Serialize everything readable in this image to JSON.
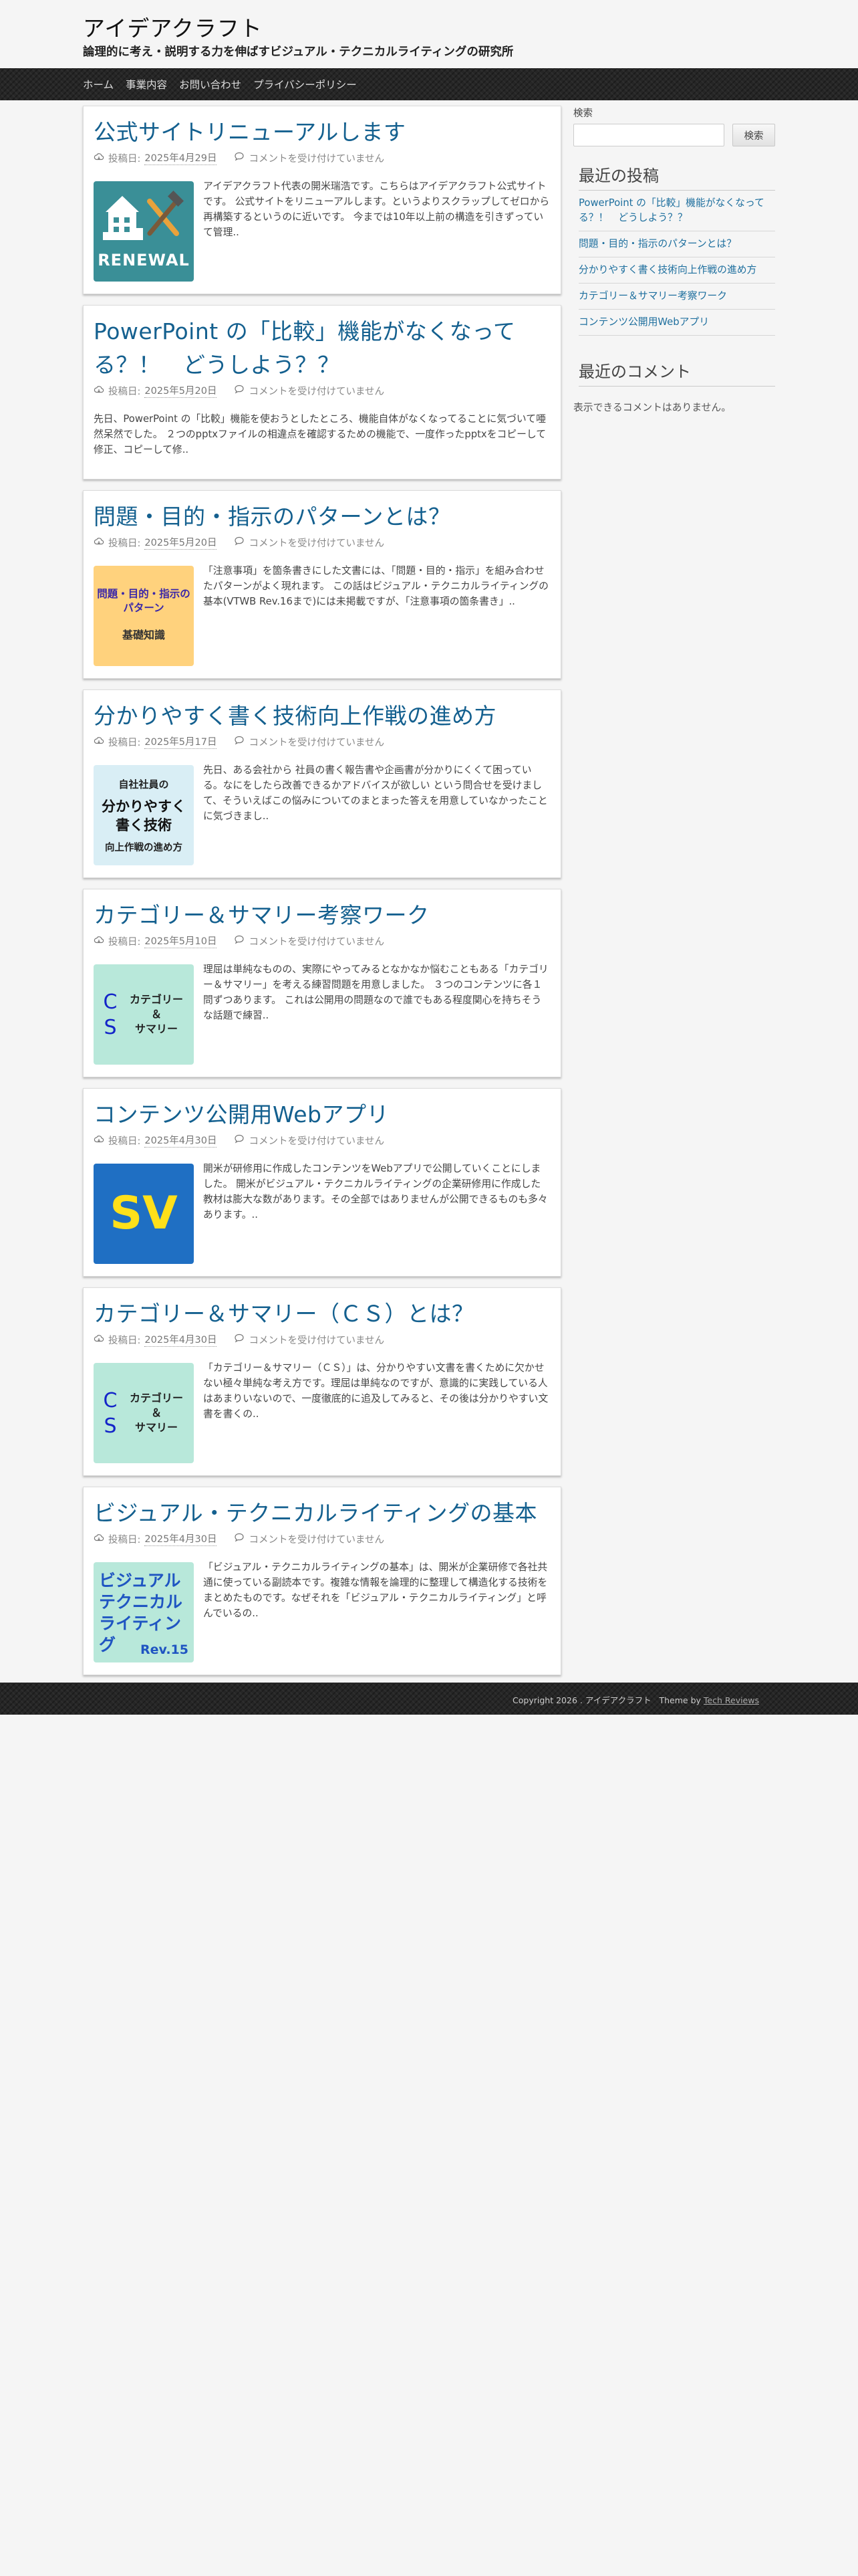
{
  "site": {
    "title": "アイデアクラフト",
    "description": "論理的に考え・説明する力を伸ばすビジュアル・テクニカルライティングの研究所"
  },
  "nav": [
    "ホーム",
    "事業内容",
    "お問い合わせ",
    "プライバシーポリシー"
  ],
  "meta_labels": {
    "posted_on": "投稿日:",
    "comments_closed": "コメントを受け付けていません"
  },
  "posts": [
    {
      "title": "公式サイトリニューアルします",
      "date": "2025年4月29日",
      "thumbnail": {
        "type": "renewal",
        "text": "RENEWAL",
        "icon": "building-tools-icon"
      },
      "excerpt": "アイデアクラフト代表の開米瑞浩です。こちらはアイデアクラフト公式サイトです。 公式サイトをリニューアルします。というよりスクラップしてゼロから再構築するというのに近いです。 今までは10年以上前の構造を引きずっていて管理.."
    },
    {
      "title": "PowerPoint の「比較」機能がなくなってる？！　どうしよう？？",
      "date": "2025年5月20日",
      "thumbnail": null,
      "excerpt": "先日、PowerPoint の「比較」機能を使おうとしたところ、機能自体がなくなってることに気づいて唖然呆然でした。 ２つのpptxファイルの相違点を確認するための機能で、一度作ったpptxをコピーして修正、コピーして修.."
    },
    {
      "title": "問題・目的・指示のパターンとは？",
      "date": "2025年5月20日",
      "thumbnail": {
        "type": "purpose",
        "line1": "問題・目的・指示の\nパターン",
        "line2": "基礎知識"
      },
      "excerpt": "「注意事項」を箇条書きにした文書には、「問題・目的・指示」を組み合わせたパターンがよく現れます。 この話はビジュアル・テクニカルライティングの基本(VTWB Rev.16まで)には未掲載ですが、「注意事項の箇条書き」.."
    },
    {
      "title": "分かりやすく書く技術向上作戦の進め方",
      "date": "2025年5月17日",
      "thumbnail": {
        "type": "write",
        "line1": "自社社員の",
        "line2": "分かりやすく\n書く技術",
        "line3": "向上作戦の進め方"
      },
      "excerpt": "先日、ある会社から 社員の書く報告書や企画書が分かりにくくて困っている。なにをしたら改善できるかアドバイスが欲しい という問合せを受けまして、そういえばこの悩みについてのまとまった答えを用意していなかったことに気づきまし.."
    },
    {
      "title": "カテゴリー＆サマリー考察ワーク",
      "date": "2025年5月10日",
      "thumbnail": {
        "type": "cs",
        "letters": "C\nS",
        "label": "カテゴリー\n＆\nサマリー"
      },
      "excerpt": "理屈は単純なものの、実際にやってみるとなかなか悩むこともある「カテゴリー＆サマリー」を考える練習問題を用意しました。 ３つのコンテンツに各１問ずつあります。 これは公開用の問題なので誰でもある程度関心を持ちそうな話題で練習.."
    },
    {
      "title": "コンテンツ公開用Webアプリ",
      "date": "2025年4月30日",
      "thumbnail": {
        "type": "sv",
        "text": "SV"
      },
      "excerpt": "開米が研修用に作成したコンテンツをWebアプリで公開していくことにしました。 開米がビジュアル・テクニカルライティングの企業研修用に作成した教材は膨大な数があります。その全部ではありませんが公開できるものも多々あります。.."
    },
    {
      "title": "カテゴリー＆サマリー（ＣＳ）とは？",
      "date": "2025年4月30日",
      "thumbnail": {
        "type": "cs",
        "letters": "C\nS",
        "label": "カテゴリー\n＆\nサマリー"
      },
      "excerpt": "「カテゴリー＆サマリー（ＣＳ）」は、分かりやすい文書を書くために欠かせない極々単純な考え方です。理屈は単純なのですが、意識的に実践している人はあまりいないので、一度徹底的に追及してみると、その後は分かりやすい文書を書くの.."
    },
    {
      "title": "ビジュアル・テクニカルライティングの基本",
      "date": "2025年4月30日",
      "thumbnail": {
        "type": "vtw",
        "text": "ビジュアル\nテクニカル\nライティング",
        "rev": "Rev.15"
      },
      "excerpt": "「ビジュアル・テクニカルライティングの基本」は、開米が企業研修で各社共通に使っている副読本です。複雑な情報を論理的に整理して構造化する技術をまとめたものです。なぜそれを「ビジュアル・テクニカルライティング」と呼んでいるの.."
    }
  ],
  "sidebar": {
    "search": {
      "label": "検索",
      "placeholder": "",
      "button": "検索"
    },
    "recent_posts_title": "最近の投稿",
    "recent_posts": [
      "PowerPoint の「比較」機能がなくなってる？！　どうしよう？？",
      "問題・目的・指示のパターンとは？",
      "分かりやすく書く技術向上作戦の進め方",
      "カテゴリー＆サマリー考察ワーク",
      "コンテンツ公開用Webアプリ"
    ],
    "recent_comments_title": "最近のコメント",
    "no_comments": "表示できるコメントはありません。"
  },
  "footer": {
    "copyright": "Copyright 2026 . アイデアクラフト",
    "theme_prefix": "Theme by",
    "theme_link": "Tech Reviews"
  },
  "colors": {
    "link": "#1e6f9e",
    "title": "#14608f",
    "nav_bg": "#262626",
    "page_bg": "#f5f5f5"
  }
}
